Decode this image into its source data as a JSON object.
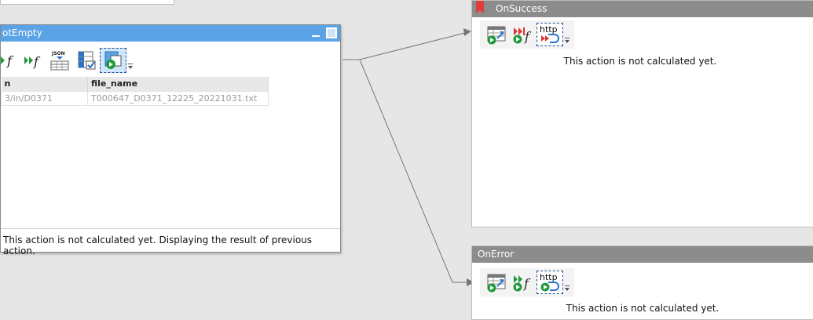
{
  "main_window": {
    "title": "otEmpty",
    "columns": [
      "n",
      "file_name"
    ],
    "rows": [
      [
        "3/in/D0371",
        "T000647_D0371_12225_20221031.txt"
      ]
    ],
    "status": "This action is not calculated yet. Displaying the result of previous action.",
    "toolbar_icons": [
      "function-icon",
      "run-function-icon",
      "json-table-icon",
      "validate-table-icon",
      "run-action-icon"
    ]
  },
  "success_window": {
    "title": "OnSuccess",
    "status": "This action is not calculated yet.",
    "http_label": "http",
    "toolbar_icons": [
      "export-table-icon",
      "skip-function-icon",
      "http-request-icon"
    ]
  },
  "error_window": {
    "title": "OnError",
    "status": "This action is not calculated yet.",
    "http_label": "http",
    "toolbar_icons": [
      "export-table-icon",
      "run-function-icon",
      "http-request-icon"
    ]
  },
  "colors": {
    "active_title": "#5aa3e6",
    "inactive_title": "#8c8c8c",
    "canvas": "#e6e6e6",
    "run_green": "#1f9a3a",
    "bookmark_red": "#e23b3b"
  }
}
